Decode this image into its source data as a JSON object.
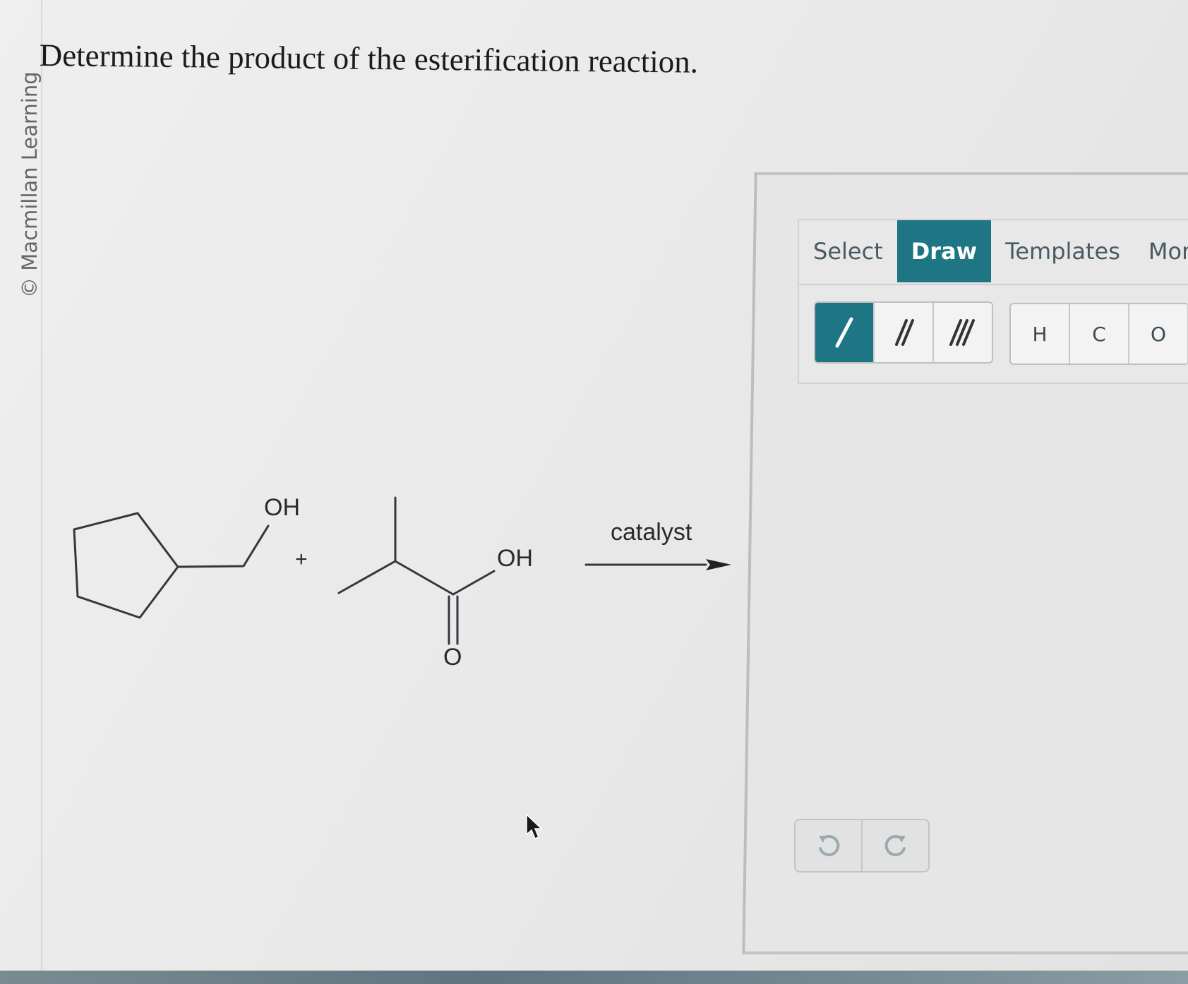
{
  "copyright": "© Macmillan Learning",
  "question": "Determine the product of the esterification reaction.",
  "reaction": {
    "reactant1_label": "OH",
    "plus": "+",
    "reactant2_oh": "OH",
    "reactant2_carbonyl_o": "O",
    "arrow_label": "catalyst"
  },
  "editor": {
    "tabs": [
      {
        "label": "Select",
        "active": false
      },
      {
        "label": "Draw",
        "active": true
      },
      {
        "label": "Templates",
        "active": false
      },
      {
        "label": "More",
        "active": false
      }
    ],
    "bond_tools": [
      "single-bond-icon",
      "double-bond-icon",
      "triple-bond-icon"
    ],
    "atoms": [
      "H",
      "C",
      "O"
    ],
    "history": [
      "undo-icon",
      "redo-icon"
    ],
    "accent_color": "#1e7584"
  }
}
